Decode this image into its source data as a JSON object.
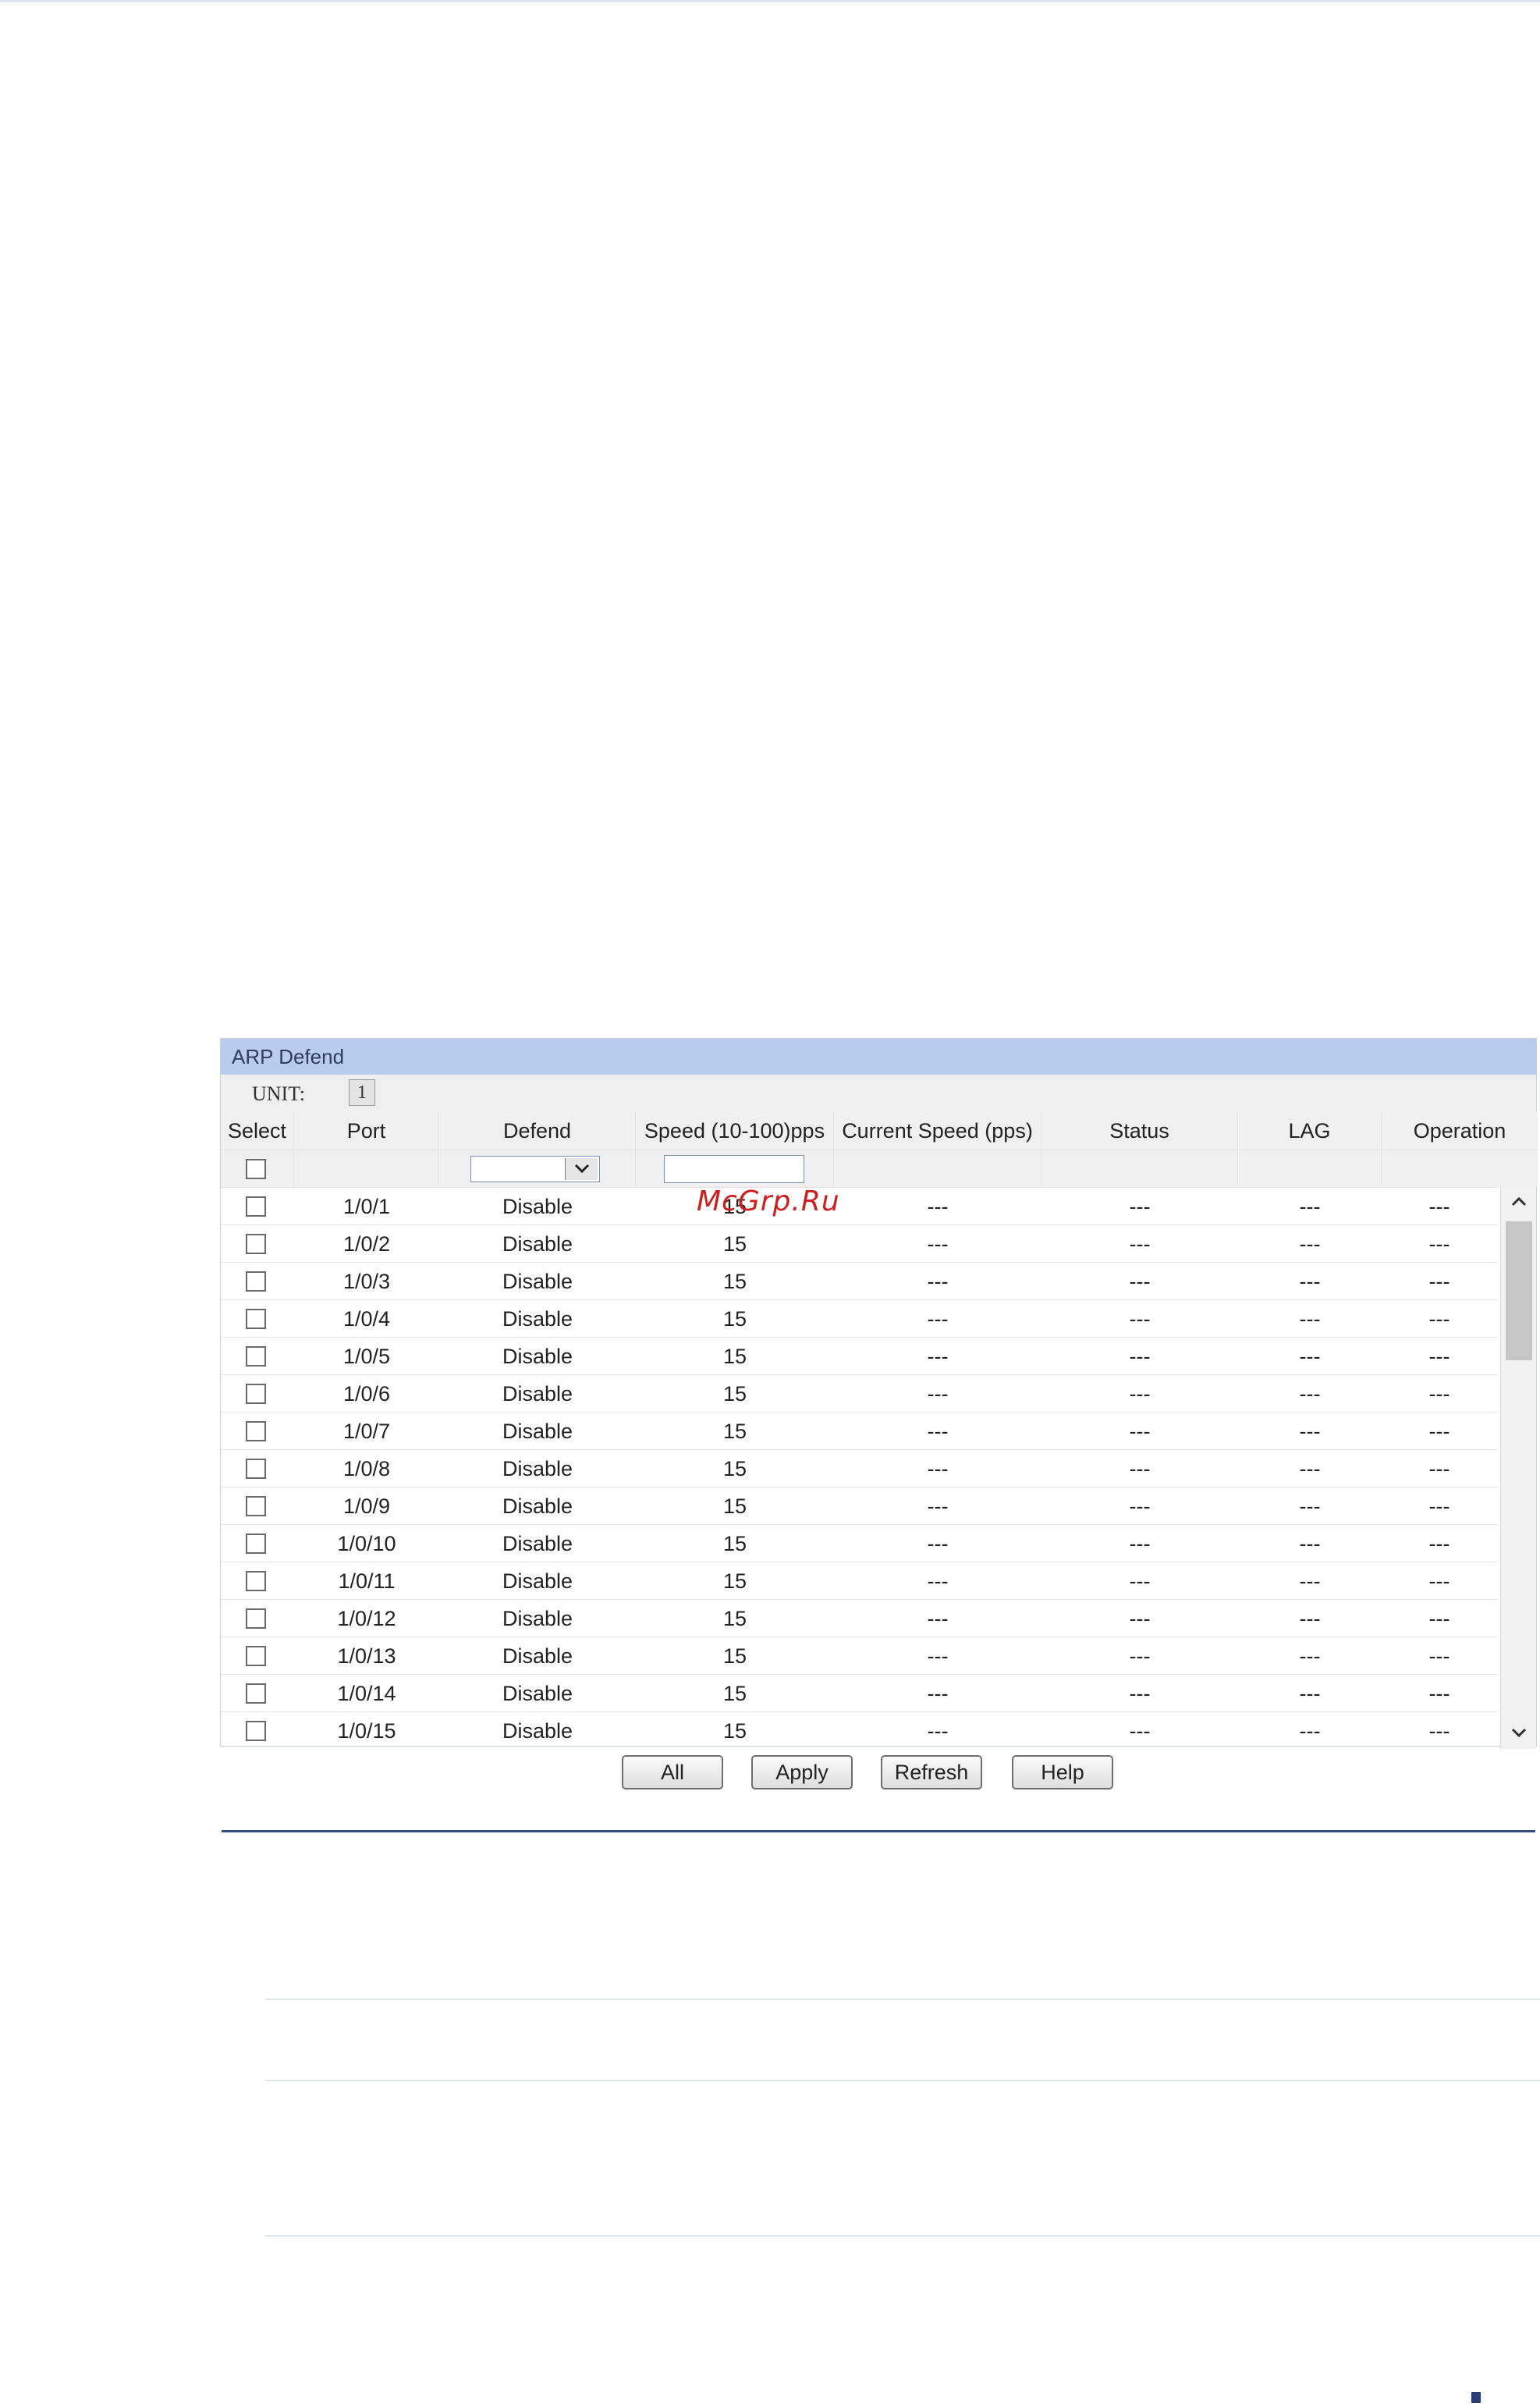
{
  "panel": {
    "title": "ARP Defend",
    "unit_label": "UNIT:",
    "unit_value": "1"
  },
  "table": {
    "headers": [
      "Select",
      "Port",
      "Defend",
      "Speed (10-100)pps",
      "Current Speed (pps)",
      "Status",
      "LAG",
      "Operation"
    ],
    "rows": [
      {
        "port": "1/0/1",
        "defend": "Disable",
        "speed": "15",
        "current": "---",
        "status": "---",
        "lag": "---",
        "operation": "---"
      },
      {
        "port": "1/0/2",
        "defend": "Disable",
        "speed": "15",
        "current": "---",
        "status": "---",
        "lag": "---",
        "operation": "---"
      },
      {
        "port": "1/0/3",
        "defend": "Disable",
        "speed": "15",
        "current": "---",
        "status": "---",
        "lag": "---",
        "operation": "---"
      },
      {
        "port": "1/0/4",
        "defend": "Disable",
        "speed": "15",
        "current": "---",
        "status": "---",
        "lag": "---",
        "operation": "---"
      },
      {
        "port": "1/0/5",
        "defend": "Disable",
        "speed": "15",
        "current": "---",
        "status": "---",
        "lag": "---",
        "operation": "---"
      },
      {
        "port": "1/0/6",
        "defend": "Disable",
        "speed": "15",
        "current": "---",
        "status": "---",
        "lag": "---",
        "operation": "---"
      },
      {
        "port": "1/0/7",
        "defend": "Disable",
        "speed": "15",
        "current": "---",
        "status": "---",
        "lag": "---",
        "operation": "---"
      },
      {
        "port": "1/0/8",
        "defend": "Disable",
        "speed": "15",
        "current": "---",
        "status": "---",
        "lag": "---",
        "operation": "---"
      },
      {
        "port": "1/0/9",
        "defend": "Disable",
        "speed": "15",
        "current": "---",
        "status": "---",
        "lag": "---",
        "operation": "---"
      },
      {
        "port": "1/0/10",
        "defend": "Disable",
        "speed": "15",
        "current": "---",
        "status": "---",
        "lag": "---",
        "operation": "---"
      },
      {
        "port": "1/0/11",
        "defend": "Disable",
        "speed": "15",
        "current": "---",
        "status": "---",
        "lag": "---",
        "operation": "---"
      },
      {
        "port": "1/0/12",
        "defend": "Disable",
        "speed": "15",
        "current": "---",
        "status": "---",
        "lag": "---",
        "operation": "---"
      },
      {
        "port": "1/0/13",
        "defend": "Disable",
        "speed": "15",
        "current": "---",
        "status": "---",
        "lag": "---",
        "operation": "---"
      },
      {
        "port": "1/0/14",
        "defend": "Disable",
        "speed": "15",
        "current": "---",
        "status": "---",
        "lag": "---",
        "operation": "---"
      },
      {
        "port": "1/0/15",
        "defend": "Disable",
        "speed": "15",
        "current": "---",
        "status": "---",
        "lag": "---",
        "operation": "---"
      }
    ]
  },
  "buttons": [
    "All",
    "Apply",
    "Refresh",
    "Help"
  ],
  "watermark": "McGrp.Ru",
  "icons": {
    "select_arrow": "chevron-down-icon",
    "scroll_up": "chevron-up-icon",
    "scroll_down": "chevron-down-icon"
  },
  "colors": {
    "title_bar": "#b8cdee",
    "rule": "#304c84",
    "watermark": "#cc1f1f"
  }
}
